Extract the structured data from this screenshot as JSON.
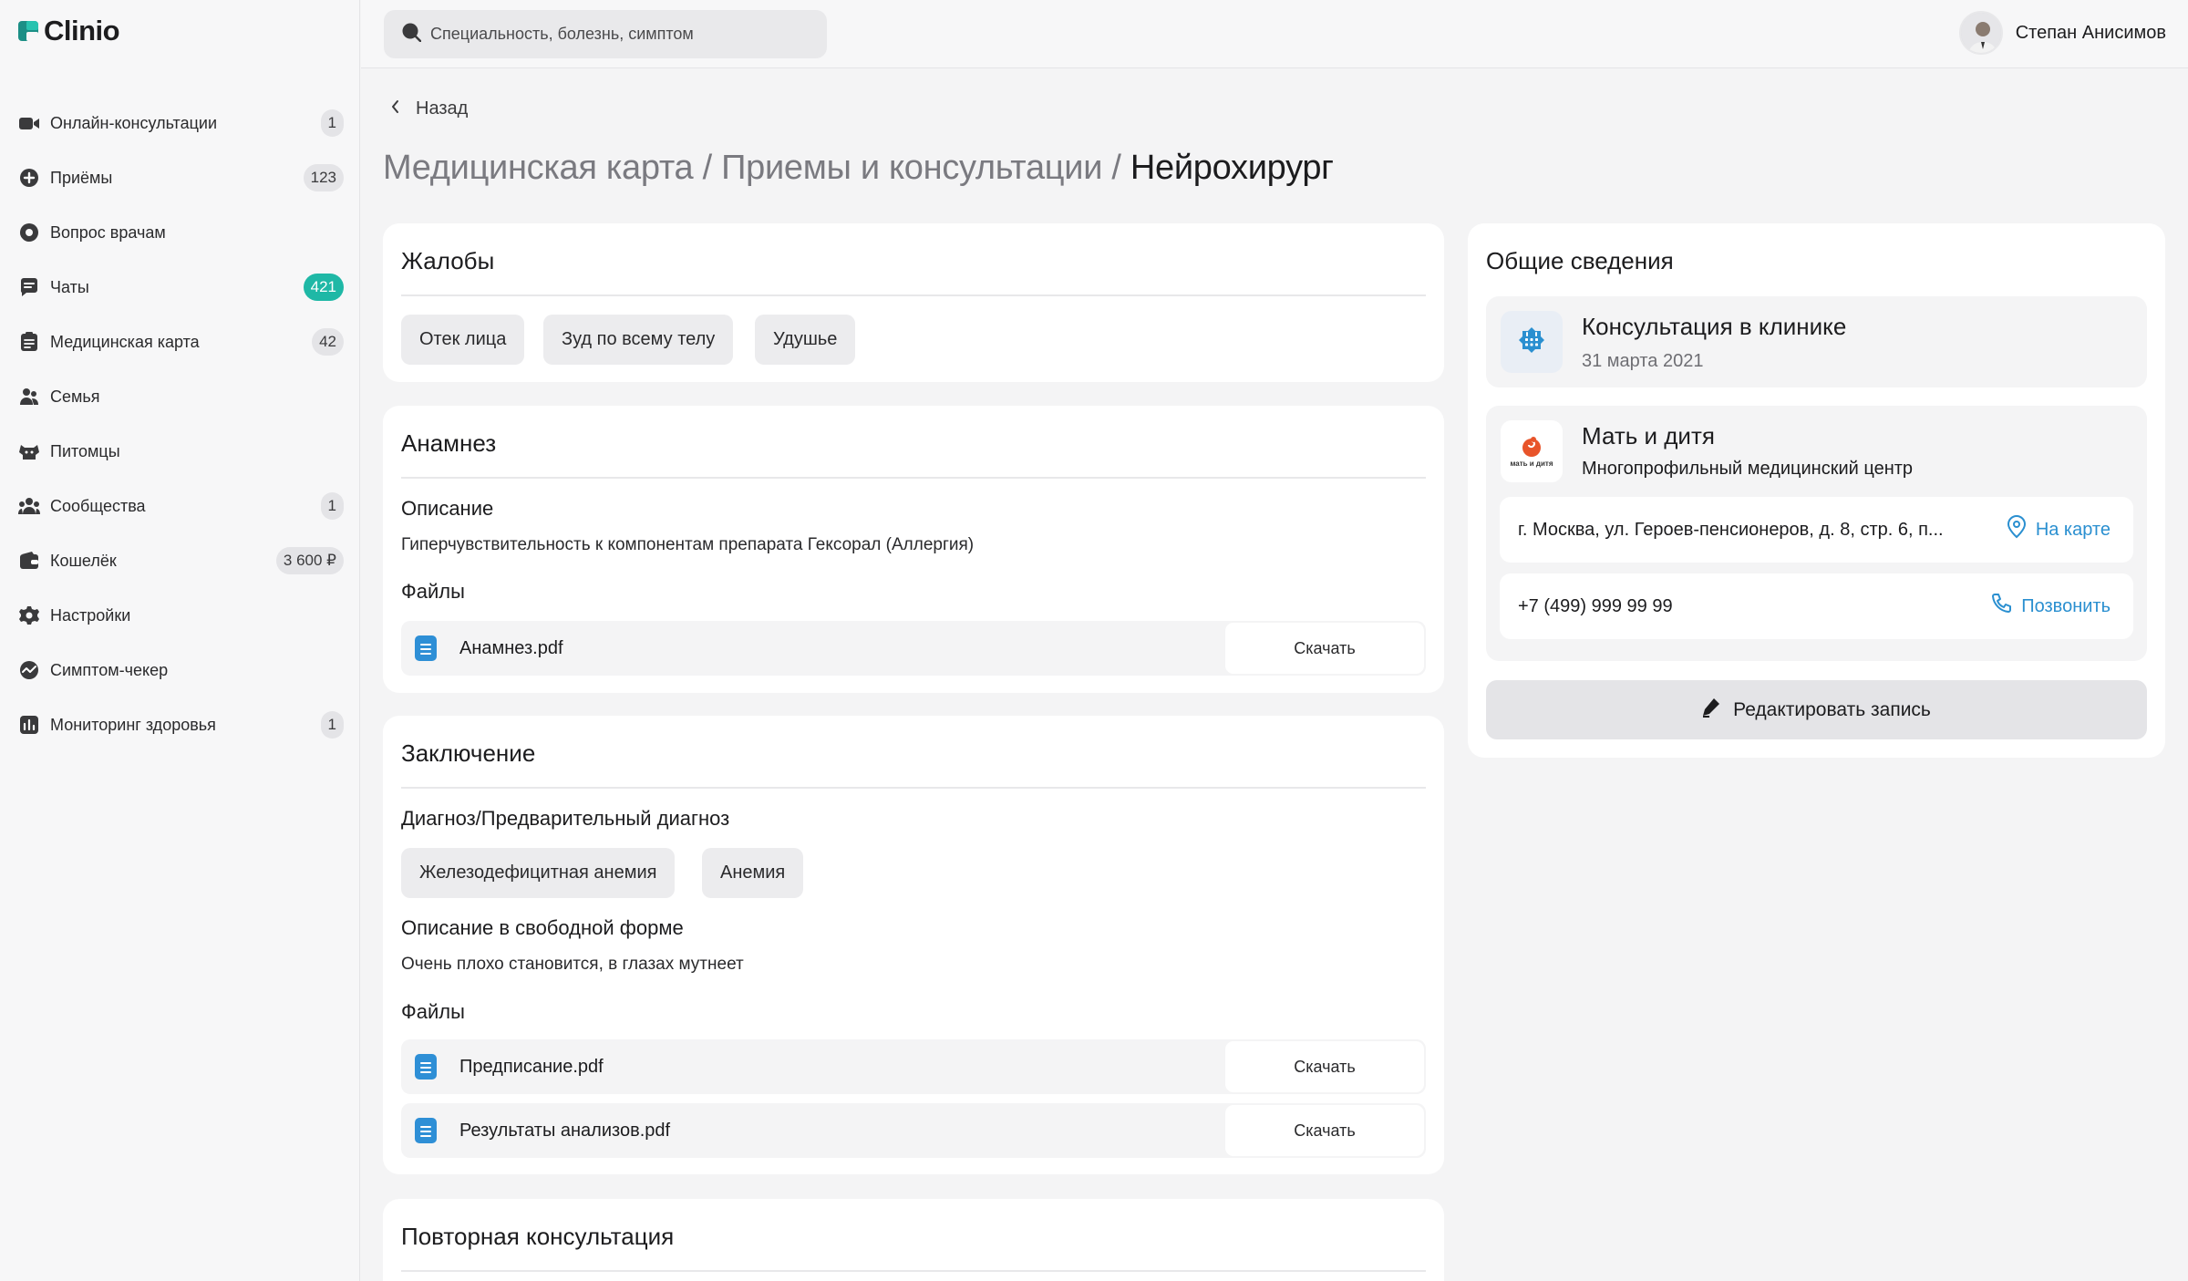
{
  "app": {
    "name": "Clinio"
  },
  "sidebar": {
    "items": [
      {
        "label": "Онлайн-консультации",
        "badge": "1",
        "icon": "video-icon"
      },
      {
        "label": "Приёмы",
        "badge": "123",
        "icon": "plus-circle-icon"
      },
      {
        "label": "Вопрос врачам",
        "badge": "",
        "icon": "chat-question-icon"
      },
      {
        "label": "Чаты",
        "badge": "421",
        "icon": "chat-icon"
      },
      {
        "label": "Медицинская карта",
        "badge": "42",
        "icon": "medical-card-icon"
      },
      {
        "label": "Семья",
        "badge": "",
        "icon": "family-icon"
      },
      {
        "label": "Питомцы",
        "badge": "",
        "icon": "pet-icon"
      },
      {
        "label": "Сообщества",
        "badge": "1",
        "icon": "community-icon"
      },
      {
        "label": "Кошелёк",
        "badge": "3 600 ₽",
        "icon": "wallet-icon"
      },
      {
        "label": "Настройки",
        "badge": "",
        "icon": "gear-icon"
      },
      {
        "label": "Симптом-чекер",
        "badge": "",
        "icon": "pulse-icon"
      },
      {
        "label": "Мониторинг здоровья",
        "badge": "1",
        "icon": "chart-icon"
      }
    ]
  },
  "search": {
    "placeholder": "Специальность, болезнь, симптом"
  },
  "user": {
    "name": "Степан Анисимов"
  },
  "nav": {
    "back": "Назад"
  },
  "breadcrumb": {
    "part1": "Медицинская карта / Приемы и консультации / ",
    "current": "Нейрохирург"
  },
  "complaints": {
    "title": "Жалобы",
    "chips": [
      "Отек лица",
      "Зуд по всему телу",
      "Удушье"
    ]
  },
  "anamnesis": {
    "title": "Анамнез",
    "desc_title": "Описание",
    "desc": "Гиперчувствительность к компонентам препарата Гексорал (Аллергия)",
    "files_title": "Файлы",
    "files": [
      {
        "name": "Анамнез.pdf",
        "action": "Скачать"
      }
    ]
  },
  "conclusion": {
    "title": "Заключение",
    "diag_title": "Диагноз/Предварительный диагноз",
    "diagnoses": [
      "Железодефицитная анемия",
      "Анемия"
    ],
    "free_title": "Описание в свободной форме",
    "free_text": "Очень плохо становится, в глазах мутнеет",
    "files_title": "Файлы",
    "files": [
      {
        "name": "Предписание.pdf",
        "action": "Скачать"
      },
      {
        "name": "Результаты анализов.pdf",
        "action": "Скачать"
      }
    ]
  },
  "followup": {
    "title": "Повторная консультация"
  },
  "general": {
    "title": "Общие сведения",
    "type": "Консультация в клинике",
    "date": "31 марта 2021",
    "clinic_name": "Мать и дитя",
    "clinic_desc": "Многопрофильный медицинский центр",
    "address": "г. Москва, ул. Героев-пенсионеров, д. 8, стр. 6, п...",
    "map_link": "На карте",
    "phone": "+7 (499) 999 99 99",
    "call_link": "Позвонить",
    "edit_button": "Редактировать запись",
    "logo_text": "мать и дитя"
  },
  "colors": {
    "accent": "#2a8fd0",
    "teal": "#1fb8a6",
    "brand_orange": "#e8542a"
  }
}
